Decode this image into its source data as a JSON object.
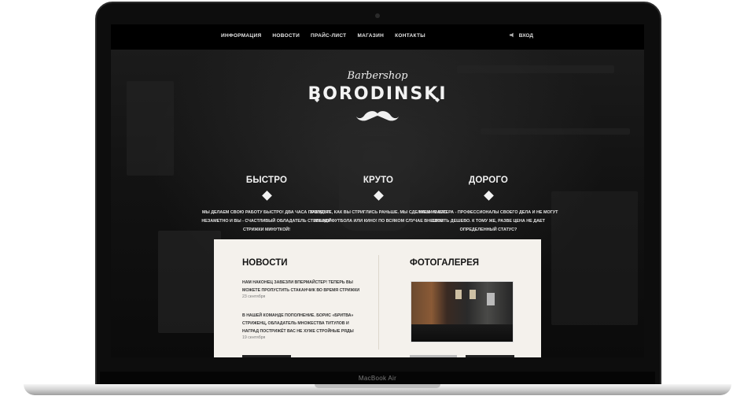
{
  "nav": {
    "items": [
      "ИНФОРМАЦИЯ",
      "НОВОСТИ",
      "ПРАЙС-ЛИСТ",
      "МАГАЗИН",
      "КОНТАКТЫ"
    ],
    "login_label": "ВХОД"
  },
  "logo": {
    "script": "Barbershop",
    "main": "BORODINSKI"
  },
  "features": [
    {
      "title": "БЫСТРО",
      "text": "МЫ ДЕЛАЕМ СВОЮ РАБОТУ БЫСТРО! ДВА ЧАСА ПРОЛЕТЯТ НЕЗАМЕТНО И ВЫ - СЧАСТЛИВЫЙ ОБЛАДАТЕЛЬ СТИЛЬНОЙ СТРИЖКИ МИНУТКОЙ!"
    },
    {
      "title": "КРУТО",
      "text": "ЗАБУДЬТЕ, КАК ВЫ СТРИГЛИСЬ РАНЬШЕ. МЫ СДЕЛАЕМ ИЗ ВАС ЗВЕЗДУ ФУТБОЛА ИЛИ КИНО! ПО ВСЯКОМ СЛУЧАЕ ВНЕШНЕ"
    },
    {
      "title": "ДОРОГО",
      "text": "НАШИ МАСТЕРА - ПРОФЕССИОНАЛЫ СВОЕГО ДЕЛА И НЕ МОГУТ СТОИТЬ ДЕШЕВО. К ТОМУ ЖЕ, РАЗВЕ ЦЕНА НЕ ДАЕТ ОПРЕДЕЛЕННЫЙ СТАТУС?"
    }
  ],
  "news": {
    "heading": "НОВОСТИ",
    "items": [
      {
        "text": "НАМ НАКОНЕЦ ЗАВЕЗЛИ ВПЕРМАЙСТЕР! ТЕПЕРЬ ВЫ МОЖЕТЕ ПРОПУСТИТЬ СТАКАНЧИК ВО ВРЕМЯ СТРИЖКИ",
        "date": "23 сентября"
      },
      {
        "text": "В НАШЕЙ КОМАНДЕ ПОПОЛНЕНИЕ. БОРИС «БРИТВА» СТРИЖЕНЦ, ОБЛАДАТЕЛЬ МНОЖЕСТВА ТИТУЛОВ И НАГРАД ПОСТРИЖЁТ ВАС НЕ ХУЖЕ СТРОЙНЫЕ РЯДЫ",
        "date": "19 сентября"
      }
    ]
  },
  "gallery": {
    "heading": "ФОТОГАЛЕРЕЯ"
  },
  "device_label": "MacBook Air"
}
